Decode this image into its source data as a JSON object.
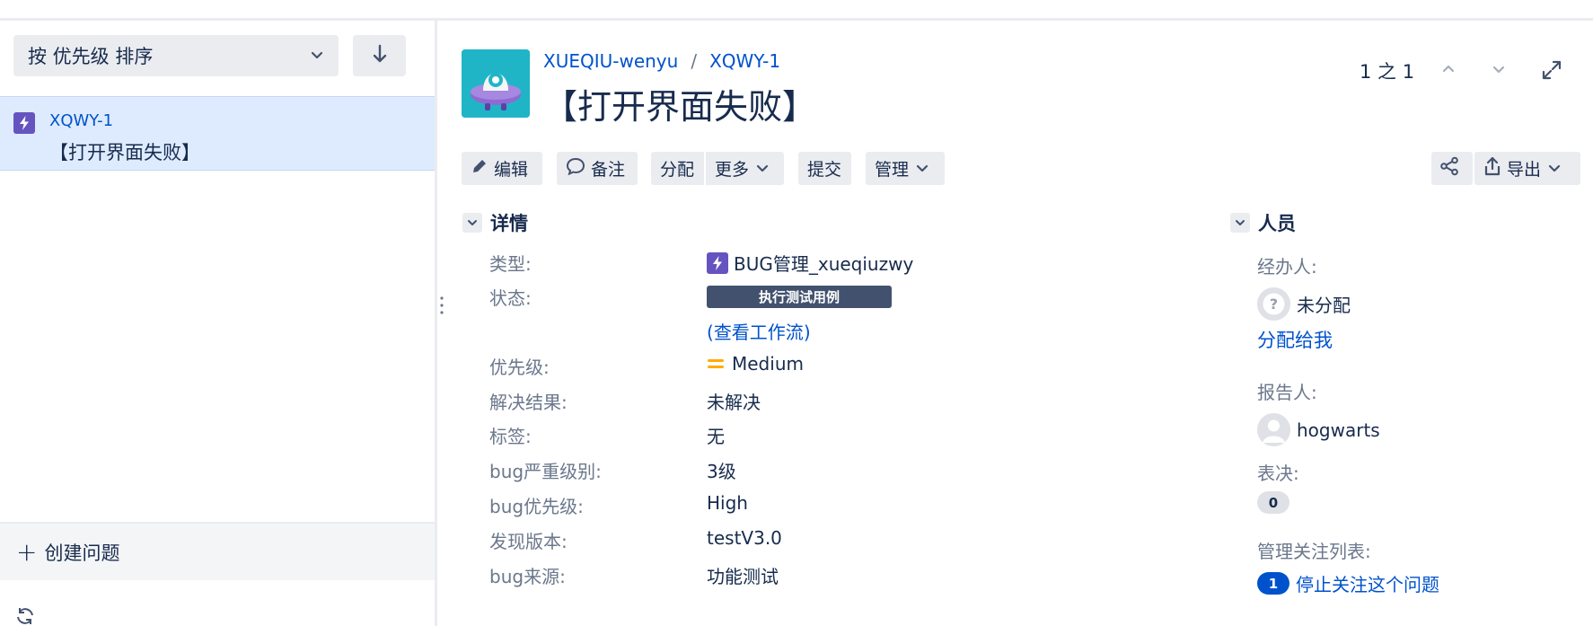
{
  "sidebar": {
    "sort_label": "按 优先级 排序",
    "issue": {
      "key": "XQWY-1",
      "summary": "【打开界面失败】"
    },
    "create_label": "创建问题"
  },
  "header": {
    "project_name": "XUEQIU-wenyu",
    "issue_key": "XQWY-1",
    "title": "【打开界面失败】",
    "pager": "1 之 1"
  },
  "toolbar": {
    "edit": "编辑",
    "comment": "备注",
    "assign": "分配",
    "more": "更多",
    "submit": "提交",
    "manage": "管理",
    "export": "导出"
  },
  "details": {
    "heading": "详情",
    "fields": [
      {
        "label": "类型:",
        "value": "BUG管理_xueqiuzwy"
      },
      {
        "label": "状态:",
        "value": "执行测试用例"
      },
      {
        "label": "优先级:",
        "value": "Medium"
      },
      {
        "label": "解决结果:",
        "value": "未解决"
      },
      {
        "label": "标签:",
        "value": "无"
      },
      {
        "label": "bug严重级别:",
        "value": "3级"
      },
      {
        "label": "bug优先级:",
        "value": "High"
      },
      {
        "label": "发现版本:",
        "value": "testV3.0"
      },
      {
        "label": "bug来源:",
        "value": "功能测试"
      }
    ],
    "workflow_link": "查看工作流",
    "paren_open": "(",
    "paren_close": ")"
  },
  "people": {
    "heading": "人员",
    "assignee_label": "经办人:",
    "assignee_value": "未分配",
    "assign_to_me": "分配给我",
    "reporter_label": "报告人:",
    "reporter_value": "hogwarts",
    "votes_label": "表决:",
    "votes_count": "0",
    "watchers_label": "管理关注列表:",
    "watchers_count": "1",
    "stop_watching": "停止关注这个问题"
  },
  "colors": {
    "link": "#0052cc",
    "status_lozenge": "#42526e",
    "selected_row": "#deebff",
    "bug_icon": "#6554c0",
    "priority_medium": "#ffab00",
    "project_avatar": "#1fb5c7"
  },
  "icons": [
    "lightning-bug-icon",
    "chevron-down-icon",
    "arrow-down-icon",
    "pencil-icon",
    "comment-icon",
    "share-icon",
    "export-icon",
    "chevron-up-icon",
    "expand-icon",
    "priority-medium-icon",
    "unknown-user-icon",
    "user-avatar-icon",
    "plus-icon",
    "refresh-icon",
    "drag-handle-icon"
  ]
}
